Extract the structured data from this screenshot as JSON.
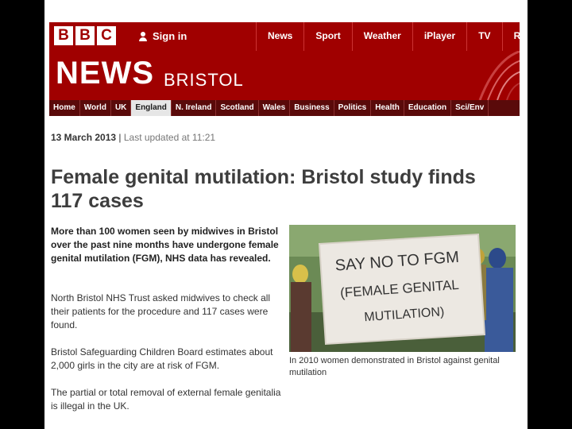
{
  "header": {
    "logo_letters": [
      "B",
      "B",
      "C"
    ],
    "signin_label": "Sign in",
    "nav_items": [
      "News",
      "Sport",
      "Weather",
      "iPlayer",
      "TV",
      "R"
    ]
  },
  "masthead": {
    "brand": "NEWS",
    "region": "BRISTOL"
  },
  "subnav": {
    "items": [
      "Home",
      "World",
      "UK",
      "England",
      "N. Ireland",
      "Scotland",
      "Wales",
      "Business",
      "Politics",
      "Health",
      "Education",
      "Sci/Env"
    ],
    "active": "England"
  },
  "article": {
    "date": "13 March 2013",
    "updated": "Last updated at 11:21",
    "headline": "Female genital mutilation: Bristol study finds 117 cases",
    "lede": "More than 100 women seen by midwives in Bristol over the past nine months have undergone female genital mutilation (FGM), NHS data has revealed.",
    "paragraphs": [
      "North Bristol NHS Trust asked midwives to check all their patients for the procedure and 117 cases were found.",
      "Bristol Safeguarding Children Board estimates about 2,000 girls in the city are at risk of FGM.",
      "The partial or total removal of external female genitalia is illegal in the UK."
    ],
    "image_caption": "In 2010 women demonstrated in Bristol against genital mutilation",
    "placard_text": [
      "SAY NO TO FGM",
      "(FEMALE GENITAL",
      "MUTILATION)"
    ]
  },
  "colors": {
    "bbc_red": "#a00000",
    "subnav_bg": "#5a0a0a",
    "active_tab_bg": "#e6e6e6",
    "headline": "#3d3d3d",
    "page_bg": "#ffffff",
    "outer_bg": "#000000"
  },
  "icons": {
    "signin": "person-icon"
  }
}
